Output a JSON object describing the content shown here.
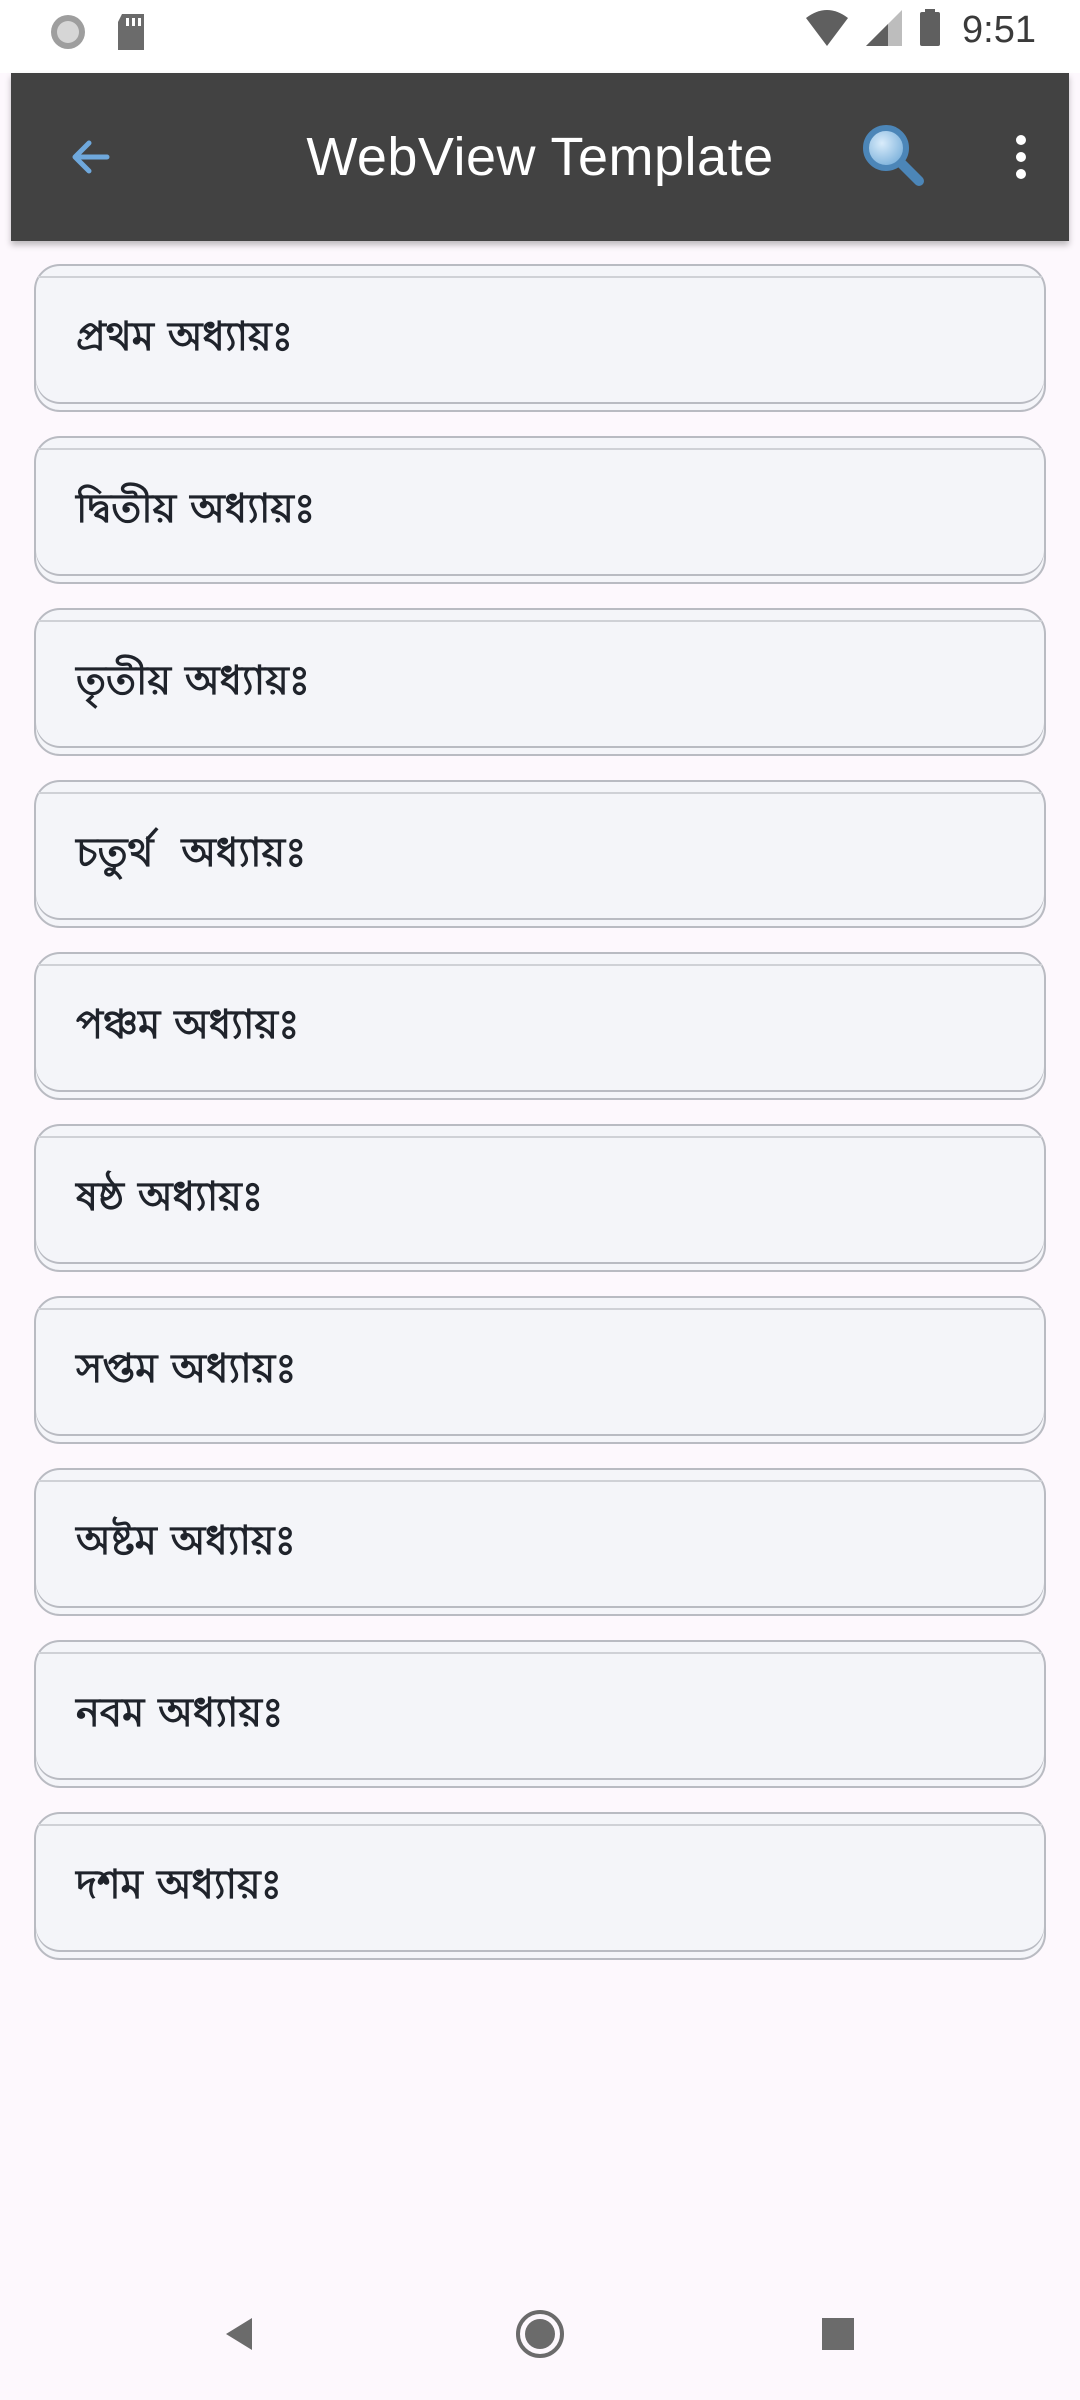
{
  "status_bar": {
    "time": "9:51",
    "icons": [
      "sync-icon",
      "sd-card-icon",
      "wifi-icon",
      "cell-signal-icon",
      "battery-icon"
    ]
  },
  "app_bar": {
    "title": "WebView Template",
    "back_icon": "arrow-left-icon",
    "search_icon": "search-icon",
    "more_icon": "more-vert-icon",
    "colors": {
      "background": "#424242",
      "accent": "#6fa8dc"
    }
  },
  "chapters": [
    {
      "label": "প্রথম অধ্যায়ঃ"
    },
    {
      "label": "দ্বিতীয় অধ্যায়ঃ"
    },
    {
      "label": "তৃতীয় অধ্যায়ঃ"
    },
    {
      "label": "চতুর্থ  অধ্যায়ঃ"
    },
    {
      "label": "পঞ্চম অধ্যায়ঃ"
    },
    {
      "label": "ষষ্ঠ অধ্যায়ঃ"
    },
    {
      "label": "সপ্তম অধ্যায়ঃ"
    },
    {
      "label": "অষ্টম অধ্যায়ঃ"
    },
    {
      "label": "নবম অধ্যায়ঃ"
    },
    {
      "label": "দশম অধ্যায়ঃ"
    }
  ],
  "nav_bar": {
    "icons": [
      "nav-back-icon",
      "nav-home-icon",
      "nav-recents-icon"
    ]
  }
}
